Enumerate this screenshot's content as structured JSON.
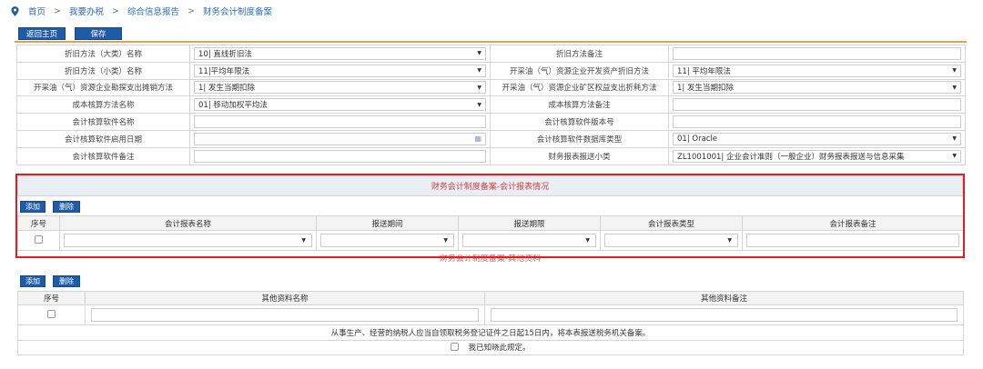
{
  "breadcrumb": {
    "items": [
      "首页",
      "我要办税",
      "综合信息报告",
      "财务会计制度备案"
    ],
    "separator": ">"
  },
  "toolbar": {
    "home_label": "返回主页",
    "save_label": "保存"
  },
  "form": {
    "depreciation_major_label": "折旧方法（大类）名称",
    "depreciation_major_value": "10| 直线折旧法",
    "depreciation_note_label": "折旧方法备注",
    "depreciation_minor_label": "折旧方法（小类）名称",
    "depreciation_minor_value": "11|平均年限法",
    "oilgas_dev_label": "开采油（气）资源企业开发资产折旧方法",
    "oilgas_dev_value": "11| 平均年限法",
    "oilgas_explore_label": "开采油（气）资源企业勘探支出摊销方法",
    "oilgas_explore_value": "1| 发生当期扣除",
    "oilgas_mining_label": "开采油（气）资源企业矿区权益支出折耗方法",
    "oilgas_mining_value": "1| 发生当期扣除",
    "cost_method_label": "成本核算方法名称",
    "cost_method_value": "01| 移动加权平均法",
    "cost_note_label": "成本核算方法备注",
    "software_name_label": "会计核算软件名称",
    "software_version_label": "会计核算软件版本号",
    "software_date_label": "会计核算软件启用日期",
    "software_db_label": "会计核算软件数据库类型",
    "software_db_value": "01| Oracle",
    "software_note_label": "会计核算软件备注",
    "report_sub_label": "财务报表报送小类",
    "report_sub_value": "ZL1001001| 企业会计准则（一般企业）财务报表报送与信息采集"
  },
  "report_section": {
    "title": "财务会计制度备案-会计报表情况",
    "add_label": "添加",
    "delete_label": "删除",
    "columns": [
      "序号",
      "会计报表名称",
      "报送期间",
      "报送期限",
      "会计报表类型",
      "会计报表备注"
    ]
  },
  "other_section": {
    "title": "财务会计制度备案-其他资料",
    "add_label": "添加",
    "delete_label": "删除",
    "columns": [
      "序号",
      "其他资料名称",
      "其他资料备注"
    ],
    "notice": "从事生产、经营的纳税人应当自领取税务登记证件之日起15日内，将本表报送税务机关备案。",
    "ack_label": "我已知晓此规定。"
  },
  "colors": {
    "accent": "#1f5ca8",
    "highlight_border": "#e51c23",
    "title_text": "#d43f3f",
    "rule": "#e8a23c"
  },
  "icons": [
    "location-pin-icon",
    "calendar-icon",
    "chevron-down-icon",
    "checkbox-icon"
  ]
}
